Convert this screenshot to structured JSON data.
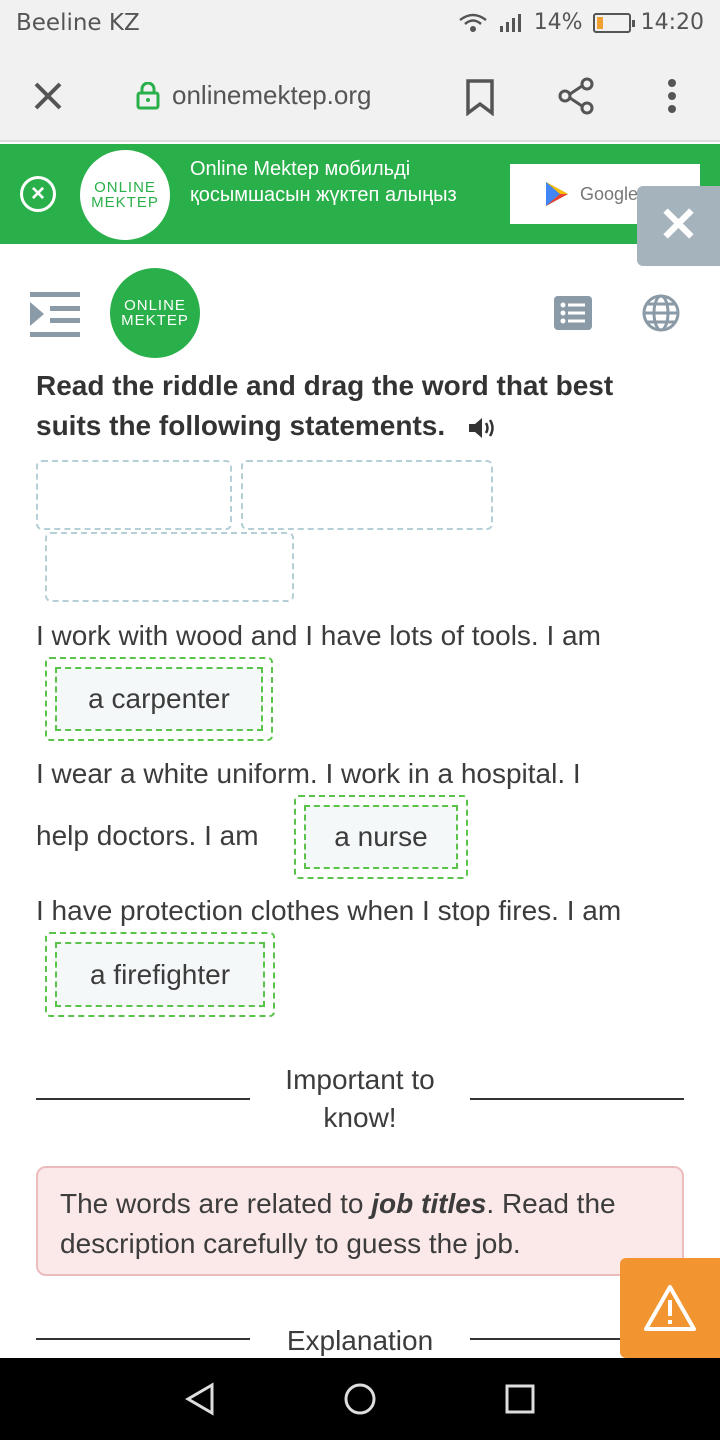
{
  "status": {
    "carrier": "Beeline KZ",
    "battery": "14%",
    "time": "14:20"
  },
  "browser": {
    "url": "onlinemektep.org",
    "icons": [
      "close-icon",
      "lock-icon",
      "bookmark-icon",
      "share-icon",
      "more-vert-icon"
    ]
  },
  "banner": {
    "logo_line1": "ONLINE",
    "logo_line2": "MEKTEP",
    "text": "Online Mektep мобильді қосымшасын жүктеп алыңыз",
    "store_label": "Google P",
    "accent": "#2ab04a"
  },
  "header": {
    "logo_line1": "ONLINE",
    "logo_line2": "MEKTEP"
  },
  "task": {
    "heading": "Read the riddle and drag the word that best suits the following statements.",
    "sentences": [
      {
        "text": "I work with wood and I have lots of tools. I am",
        "answer": "a carpenter"
      },
      {
        "text_line1": "I wear a white uniform. I work in a hospital. I",
        "text_line2": "help doctors. I am",
        "answer": "a nurse"
      },
      {
        "text": "I have protection clothes when I stop fires. I am",
        "answer": "a firefighter"
      }
    ]
  },
  "important": {
    "title": "Important to know!",
    "text_before": "The words are related to ",
    "text_bold": "job titles",
    "text_after": ". Read the description carefully to guess the job."
  },
  "explanation": {
    "title": "Explanation"
  },
  "colors": {
    "green": "#2ab04a",
    "chip_border": "#5ac44a",
    "notice_bg": "#fbe9e9",
    "warn": "#f29430"
  }
}
